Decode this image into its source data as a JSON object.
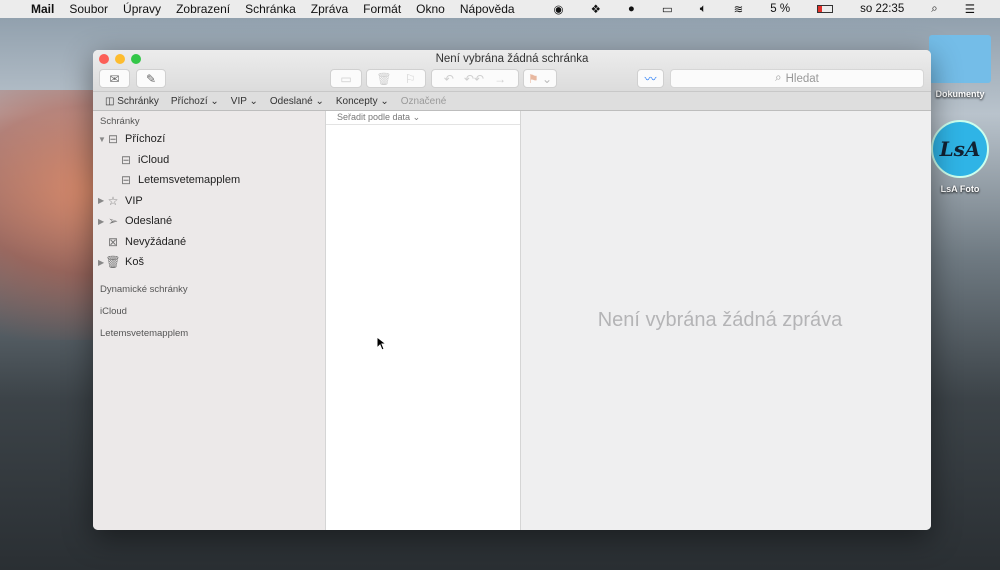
{
  "menubar": {
    "apple": "",
    "app": "Mail",
    "items": [
      "Soubor",
      "Úpravy",
      "Zobrazení",
      "Schránka",
      "Zpráva",
      "Formát",
      "Okno",
      "Nápověda"
    ],
    "battery": "5 %",
    "battery_level": 0.05,
    "clock": "so 22:35"
  },
  "window": {
    "title": "Není vybrána žádná schránka",
    "search_placeholder": "Hledat"
  },
  "favorites": {
    "mailboxes": "Schránky",
    "items": [
      "Příchozí",
      "VIP",
      "Odeslané",
      "Koncepty"
    ],
    "flagged": "Označené"
  },
  "sidebar": {
    "header": "Schránky",
    "inbox": "Příchozí",
    "inbox_children": [
      "iCloud",
      "Letemsvetemapplem"
    ],
    "vip": "VIP",
    "sent": "Odeslané",
    "junk": "Nevyžádané",
    "trash": "Koš",
    "sections": [
      "Dynamické schránky",
      "iCloud",
      "Letemsvetemapplem"
    ]
  },
  "list": {
    "sort": "Seřadit podle data"
  },
  "viewer": {
    "empty": "Není vybrána žádná zpráva"
  },
  "desktop": {
    "icons": [
      "Dokumenty",
      "LsA Foto"
    ],
    "logo_text": "LsA"
  }
}
